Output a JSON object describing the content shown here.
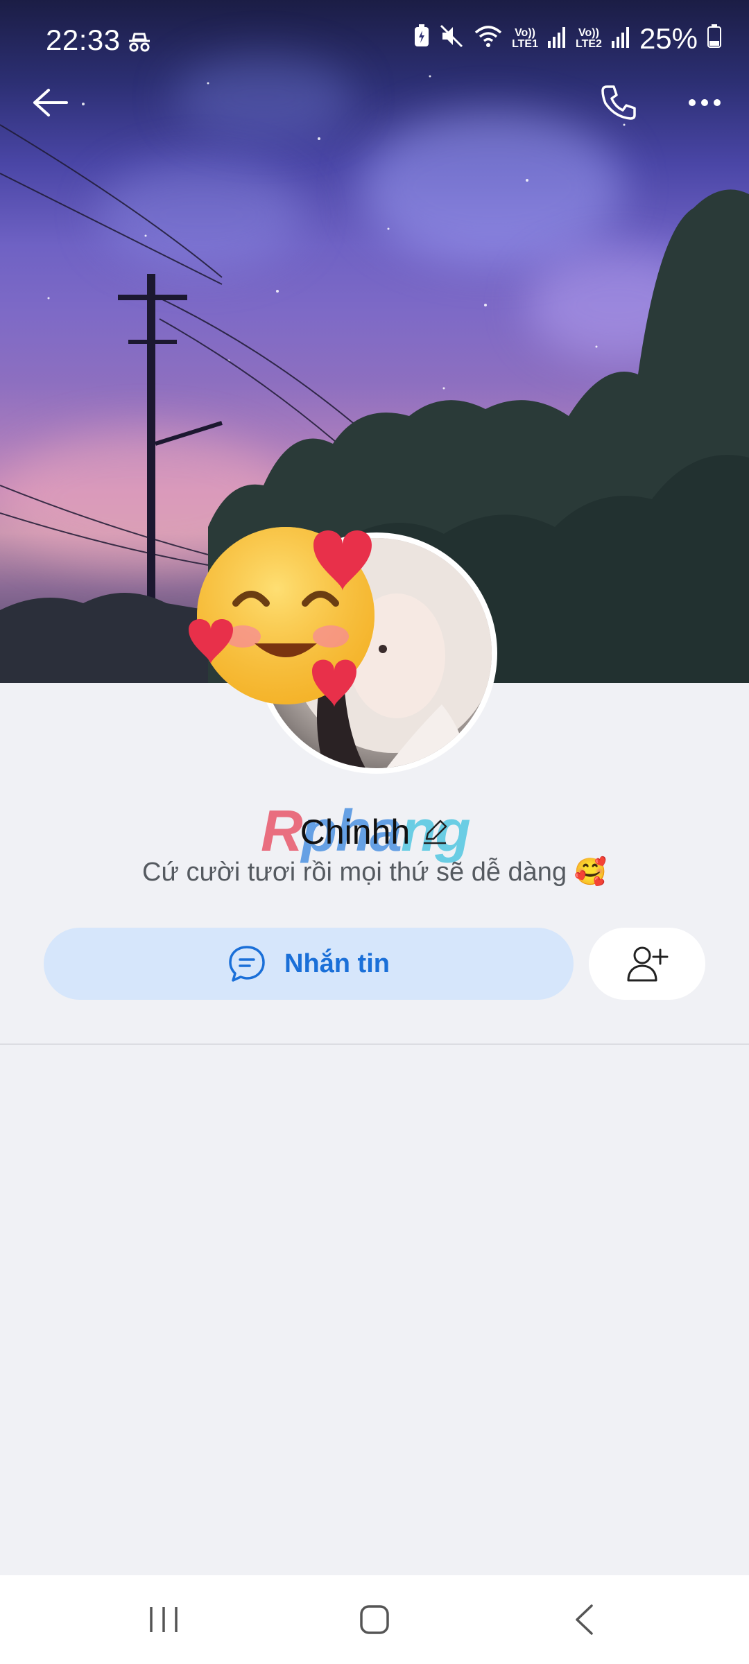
{
  "status_bar": {
    "time": "22:33",
    "sim1": "Vo)) LTE1",
    "sim2": "Vo)) LTE2",
    "sim1_top": "Vo))",
    "sim1_bottom": "LTE1",
    "sim2_top": "Vo))",
    "sim2_bottom": "LTE2",
    "battery": "25%",
    "icons": [
      "incognito-icon",
      "battery-saver-icon",
      "mute-icon",
      "wifi-icon",
      "signal-icon",
      "battery-icon"
    ]
  },
  "header": {
    "back_icon": "arrow-left-icon",
    "call_icon": "phone-icon",
    "more_icon": "more-horizontal-icon"
  },
  "profile": {
    "name": "Chinhh",
    "bio": "Cứ cười tươi rồi mọi thứ sẽ dễ dàng 🥰",
    "sticker": "🥰",
    "watermark": {
      "part1": "R",
      "part2": "pha",
      "part3": "ng"
    }
  },
  "actions": {
    "message_label": "Nhắn tin",
    "message_icon": "chat-bubble-icon",
    "add_friend_icon": "add-user-icon"
  },
  "colors": {
    "accent": "#1a6fd8",
    "message_button_bg": "#d6e6fb",
    "page_bg": "#f0f1f5"
  },
  "nav_bar": {
    "items": [
      "recent-apps-icon",
      "home-icon",
      "back-icon"
    ]
  }
}
